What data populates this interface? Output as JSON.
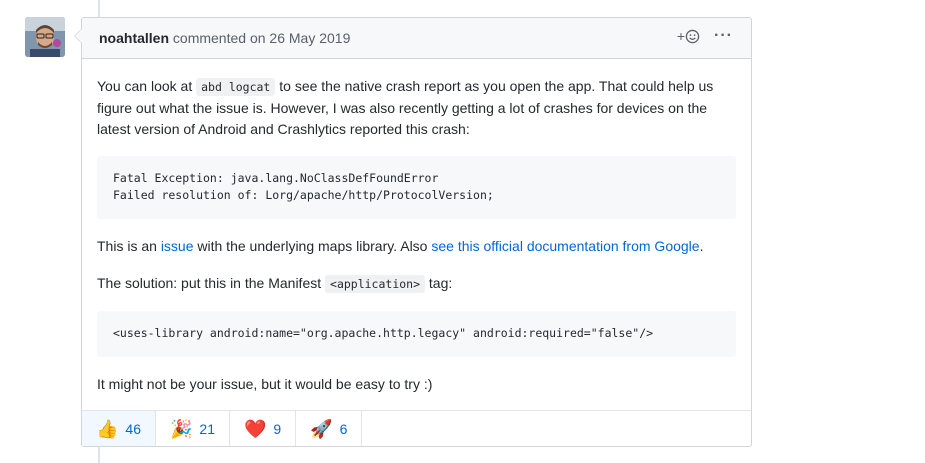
{
  "comment": {
    "author": "noahtallen",
    "action": "commented on",
    "date": "26 May 2019",
    "add_reaction_plus": "+",
    "more_label": "···",
    "para1_before": "You can look at ",
    "para1_code": "abd logcat",
    "para1_after": " to see the native crash report as you open the app. That could help us figure out what the issue is. However, I was also recently getting a lot of crashes for devices on the latest version of Android and Crashlytics reported this crash:",
    "code_block_1": "Fatal Exception: java.lang.NoClassDefFoundError\nFailed resolution of: Lorg/apache/http/ProtocolVersion;",
    "para2_before": "This is an ",
    "para2_link1": "issue",
    "para2_middle": " with the underlying maps library. Also ",
    "para2_link2": "see this official documentation from Google",
    "para2_after": ".",
    "para3_before": "The solution: put this in the Manifest ",
    "para3_code": "<application>",
    "para3_after": " tag:",
    "code_block_2": "<uses-library android:name=\"org.apache.http.legacy\" android:required=\"false\"/>",
    "para4": "It might not be your issue, but it would be easy to try :)"
  },
  "reactions": [
    {
      "icon": "thumbs-up",
      "emoji": "👍",
      "count": "46"
    },
    {
      "icon": "party-popper",
      "emoji": "🎉",
      "count": "21"
    },
    {
      "icon": "heart",
      "emoji": "❤️",
      "count": "9"
    },
    {
      "icon": "rocket",
      "emoji": "🚀",
      "count": "6"
    }
  ],
  "colors": {
    "link": "#0366d6",
    "border": "#d1d5da",
    "header_bg": "#f6f8fa"
  }
}
